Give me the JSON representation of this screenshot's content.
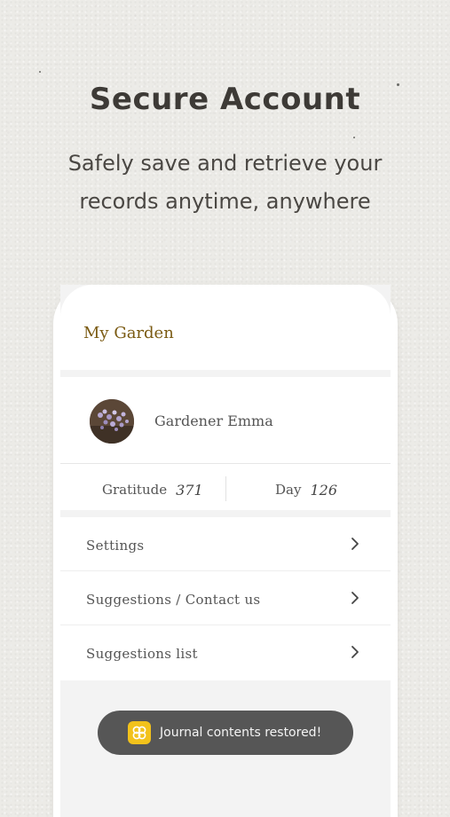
{
  "hero": {
    "title": "Secure Account",
    "subtitle": "Safely save and retrieve your\nrecords anytime, anywhere"
  },
  "app": {
    "title": "My Garden",
    "profile": {
      "name": "Gardener Emma",
      "avatar_icon": "flower-photo-avatar"
    },
    "stats": {
      "gratitude_label": "Gratitude",
      "gratitude_value": "371",
      "day_label": "Day",
      "day_value": "126"
    },
    "menu": [
      {
        "label": "Settings",
        "icon": "chevron-right-icon"
      },
      {
        "label": "Suggestions / Contact us",
        "icon": "chevron-right-icon"
      },
      {
        "label": "Suggestions list",
        "icon": "chevron-right-icon"
      }
    ],
    "toast": {
      "text": "Journal contents restored!",
      "icon": "app-logo-icon"
    }
  },
  "colors": {
    "accent": "#7a5a12",
    "toast_bg": "#565656",
    "toast_icon": "#f2c21b",
    "background": "#ecebe7"
  }
}
